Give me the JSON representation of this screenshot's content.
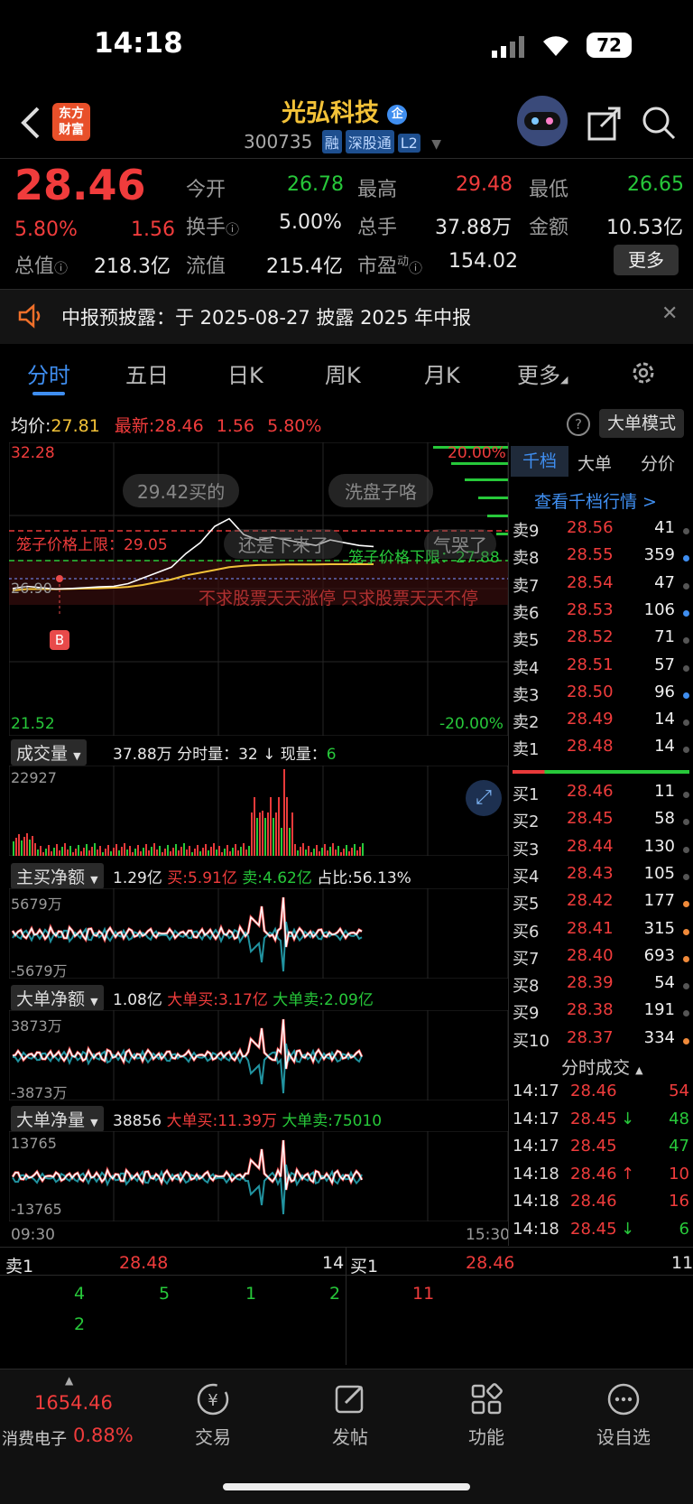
{
  "status_bar": {
    "time": "14:18",
    "battery": "72"
  },
  "header": {
    "brand_line1": "东方",
    "brand_line2": "财富",
    "stock_name": "光弘科技",
    "enterprise_badge": "企",
    "stock_code": "300735",
    "tags": [
      "融",
      "深股通",
      "L2"
    ]
  },
  "quote": {
    "price": "28.46",
    "change_pct": "5.80%",
    "change": "1.56",
    "open_label": "今开",
    "open": "26.78",
    "high_label": "最高",
    "high": "29.48",
    "low_label": "最低",
    "low": "26.65",
    "turnover_label": "换手",
    "turnover": "5.00%",
    "volume_label": "总手",
    "volume": "37.88万",
    "amount_label": "金额",
    "amount": "10.53亿",
    "mcap_label": "总值",
    "mcap": "218.3亿",
    "float_label": "流值",
    "float": "215.4亿",
    "pe_label": "市盈",
    "pe_sup": "动",
    "pe": "154.02",
    "more_button": "更多"
  },
  "notice": {
    "text": "中报预披露：于 2025-08-27 披露 2025 年中报"
  },
  "tabs": [
    "分时",
    "五日",
    "日K",
    "周K",
    "月K",
    "更多"
  ],
  "chart_header": {
    "avg_label": "均价:",
    "avg": "27.81",
    "latest_label": "最新:",
    "latest": "28.46",
    "change": "1.56",
    "change_pct": "5.80%",
    "mode_button": "大单模式"
  },
  "price_chart": {
    "top_price": "32.28",
    "top_pct": "20.00%",
    "bottom_price": "21.52",
    "bottom_pct": "-20.00%",
    "mid_price": "26.90",
    "upper_limit_label": "笼子价格上限：29.05",
    "lower_limit_label": "笼子价格下限：27.88",
    "marker": "B",
    "danmaku": [
      "29.42买的",
      "洗盘子咯",
      "还是下来了",
      "气哭了",
      "不求股票天天涨停 只求股票天天不停"
    ]
  },
  "chart_data": {
    "type": "line",
    "series": [
      {
        "values": [
          26.92,
          27.0,
          26.95,
          26.9,
          26.92,
          26.95,
          26.98,
          27.0,
          27.1,
          27.3,
          27.5,
          27.7,
          28.2,
          28.6,
          29.2,
          29.48,
          28.9,
          28.7,
          28.8,
          28.7,
          28.6,
          28.5,
          28.7,
          28.6,
          28.5,
          28.46
        ]
      },
      {
        "values": [
          26.85,
          26.9,
          26.9,
          26.9,
          26.91,
          26.92,
          26.93,
          26.95,
          26.98,
          27.05,
          27.15,
          27.25,
          27.4,
          27.5,
          27.6,
          27.7,
          27.75,
          27.78,
          27.79,
          27.8,
          27.8,
          27.8,
          27.81,
          27.81,
          27.81,
          27.81
        ]
      }
    ],
    "ylim": [
      21.52,
      32.28
    ]
  },
  "volume": {
    "label": "成交量",
    "summary": "37.88万 分时量：32 ↓ 现量：",
    "current": "6",
    "max": "22927"
  },
  "main_net": {
    "label": "主买净额",
    "value": "1.29亿",
    "buy": "买:5.91亿",
    "sell": "卖:4.62亿",
    "ratio": "占比:56.13%",
    "top": "5679万",
    "bottom": "-5679万"
  },
  "large_net": {
    "label": "大单净额",
    "value": "1.08亿",
    "buy": "大单买:3.17亿",
    "sell": "大单卖:2.09亿",
    "top": "3873万",
    "bottom": "-3873万"
  },
  "large_qty": {
    "label": "大单净量",
    "value": "38856",
    "buy": "大单买:11.39万",
    "sell": "大单卖:75010",
    "top": "13765",
    "bottom": "-13765"
  },
  "time_axis": {
    "start": "09:30",
    "end": "15:30"
  },
  "order_book": {
    "tabs": [
      "千档",
      "大单",
      "分价"
    ],
    "link": "查看千档行情 >",
    "asks": [
      {
        "label": "卖9",
        "price": "28.56",
        "qty": "41",
        "dot": "gray"
      },
      {
        "label": "卖8",
        "price": "28.55",
        "qty": "359",
        "dot": "blue"
      },
      {
        "label": "卖7",
        "price": "28.54",
        "qty": "47",
        "dot": "gray"
      },
      {
        "label": "卖6",
        "price": "28.53",
        "qty": "106",
        "dot": "blue"
      },
      {
        "label": "卖5",
        "price": "28.52",
        "qty": "71",
        "dot": "gray"
      },
      {
        "label": "卖4",
        "price": "28.51",
        "qty": "57",
        "dot": "gray"
      },
      {
        "label": "卖3",
        "price": "28.50",
        "qty": "96",
        "dot": "blue"
      },
      {
        "label": "卖2",
        "price": "28.49",
        "qty": "14",
        "dot": "gray"
      },
      {
        "label": "卖1",
        "price": "28.48",
        "qty": "14",
        "dot": "gray"
      }
    ],
    "bids": [
      {
        "label": "买1",
        "price": "28.46",
        "qty": "11",
        "dot": "gray"
      },
      {
        "label": "买2",
        "price": "28.45",
        "qty": "58",
        "dot": "gray"
      },
      {
        "label": "买3",
        "price": "28.44",
        "qty": "130",
        "dot": "gray"
      },
      {
        "label": "买4",
        "price": "28.43",
        "qty": "105",
        "dot": "gray"
      },
      {
        "label": "买5",
        "price": "28.42",
        "qty": "177",
        "dot": "orange"
      },
      {
        "label": "买6",
        "price": "28.41",
        "qty": "315",
        "dot": "orange"
      },
      {
        "label": "买7",
        "price": "28.40",
        "qty": "693",
        "dot": "orange"
      },
      {
        "label": "买8",
        "price": "28.39",
        "qty": "54",
        "dot": "gray"
      },
      {
        "label": "买9",
        "price": "28.38",
        "qty": "191",
        "dot": "gray"
      },
      {
        "label": "买10",
        "price": "28.37",
        "qty": "334",
        "dot": "orange"
      }
    ],
    "trades_title": "分时成交",
    "trades": [
      {
        "time": "14:17",
        "price": "28.46",
        "arrow": "",
        "qty": "54",
        "qcolor": "red"
      },
      {
        "time": "14:17",
        "price": "28.45",
        "arrow": "↓",
        "qty": "48",
        "qcolor": "green"
      },
      {
        "time": "14:17",
        "price": "28.45",
        "arrow": "",
        "qty": "47",
        "qcolor": "green"
      },
      {
        "time": "14:18",
        "price": "28.46",
        "arrow": "↑",
        "qty": "10",
        "qcolor": "red"
      },
      {
        "time": "14:18",
        "price": "28.46",
        "arrow": "",
        "qty": "16",
        "qcolor": "red"
      },
      {
        "time": "14:18",
        "price": "28.45",
        "arrow": "↓",
        "qty": "6",
        "qcolor": "green"
      }
    ]
  },
  "level1": {
    "sell_label": "卖1",
    "sell_price": "28.48",
    "sell_qty": "14",
    "buy_label": "买1",
    "buy_price": "28.46",
    "buy_qty": "11",
    "sell_queue_row1": [
      "4",
      "5",
      "1",
      "2"
    ],
    "sell_queue_row2": [
      "2"
    ],
    "buy_queue": [
      "11"
    ]
  },
  "bottom_nav": {
    "index_value": "1654.46",
    "index_name": "消费电子",
    "index_pct": "0.88%",
    "items": [
      "交易",
      "发帖",
      "功能",
      "设自选"
    ]
  },
  "colors": {
    "up": "#f03c3c",
    "down": "#27c83a",
    "accent": "#3f8ef0",
    "gold": "#f3c238"
  }
}
